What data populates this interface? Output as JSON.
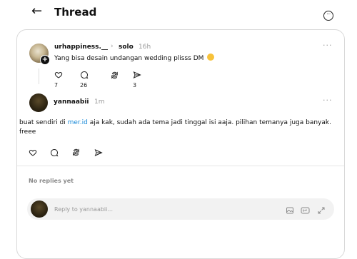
{
  "header": {
    "back_icon": "arrow-left-icon",
    "title": "Thread",
    "more_icon": "more-circle-icon"
  },
  "original_post": {
    "username": "urhappiness.__",
    "reply_to": "solo",
    "time": "16h",
    "text": "Yang bisa desain undangan wedding plisss DM",
    "likes": "7",
    "comments": "26",
    "shares": "3"
  },
  "reply_post": {
    "username": "yannaabii",
    "time": "1m",
    "text_before": "buat sendiri di ",
    "link": "mer.id",
    "text_after": " aja kak, sudah ada tema jadi tinggal isi aaja. pilihan temanya juga banyak. freee"
  },
  "no_replies": "No replies yet",
  "composer": {
    "placeholder": "Reply to yannaabii..."
  }
}
